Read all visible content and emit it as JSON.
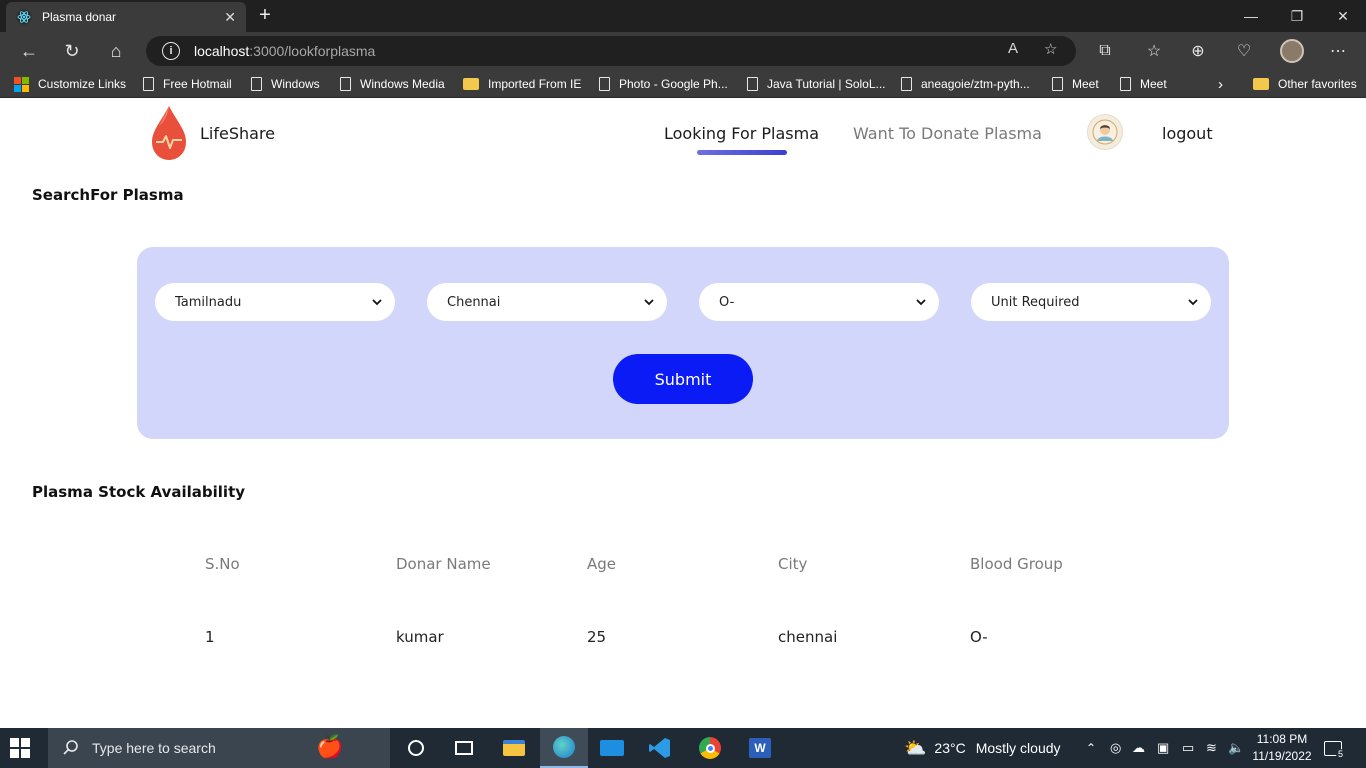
{
  "browser": {
    "tab_title": "Plasma donar",
    "new_tab": "+",
    "url_host": "localhost",
    "url_path": ":3000/lookforplasma",
    "favorites": [
      {
        "label": "Customize Links",
        "kind": "ms"
      },
      {
        "label": "Free Hotmail",
        "kind": "page"
      },
      {
        "label": "Windows",
        "kind": "page"
      },
      {
        "label": "Windows Media",
        "kind": "page"
      },
      {
        "label": "Imported From IE",
        "kind": "folder"
      },
      {
        "label": "Photo - Google Ph...",
        "kind": "page"
      },
      {
        "label": "Java Tutorial | SoloL...",
        "kind": "page"
      },
      {
        "label": "aneagoie/ztm-pyth...",
        "kind": "page"
      },
      {
        "label": "Meet",
        "kind": "page"
      },
      {
        "label": "Meet",
        "kind": "page"
      }
    ],
    "other_favorites": "Other favorites"
  },
  "site": {
    "brand": "LifeShare",
    "nav": {
      "looking": "Looking For Plasma",
      "donate": "Want To Donate Plasma",
      "logout": "logout"
    },
    "search_title": "SearchFor Plasma",
    "filters": {
      "state": "Tamilnadu",
      "city": "Chennai",
      "blood_group": "O-",
      "units": "Unit Required"
    },
    "submit": "Submit",
    "stock_title": "Plasma Stock Availability",
    "table": {
      "headers": [
        "S.No",
        "Donar Name",
        "Age",
        "City",
        "Blood Group"
      ],
      "rows": [
        [
          "1",
          "kumar",
          "25",
          "chennai",
          "O-"
        ]
      ]
    }
  },
  "taskbar": {
    "search_placeholder": "Type here to search",
    "weather_temp": "23°C",
    "weather_text": "Mostly cloudy",
    "time": "11:08 PM",
    "date": "11/19/2022",
    "notifications": "5"
  },
  "colors": {
    "accent": "#0a1bf5",
    "card_bg": "#d3d6fb",
    "drop": "#e8503c"
  }
}
